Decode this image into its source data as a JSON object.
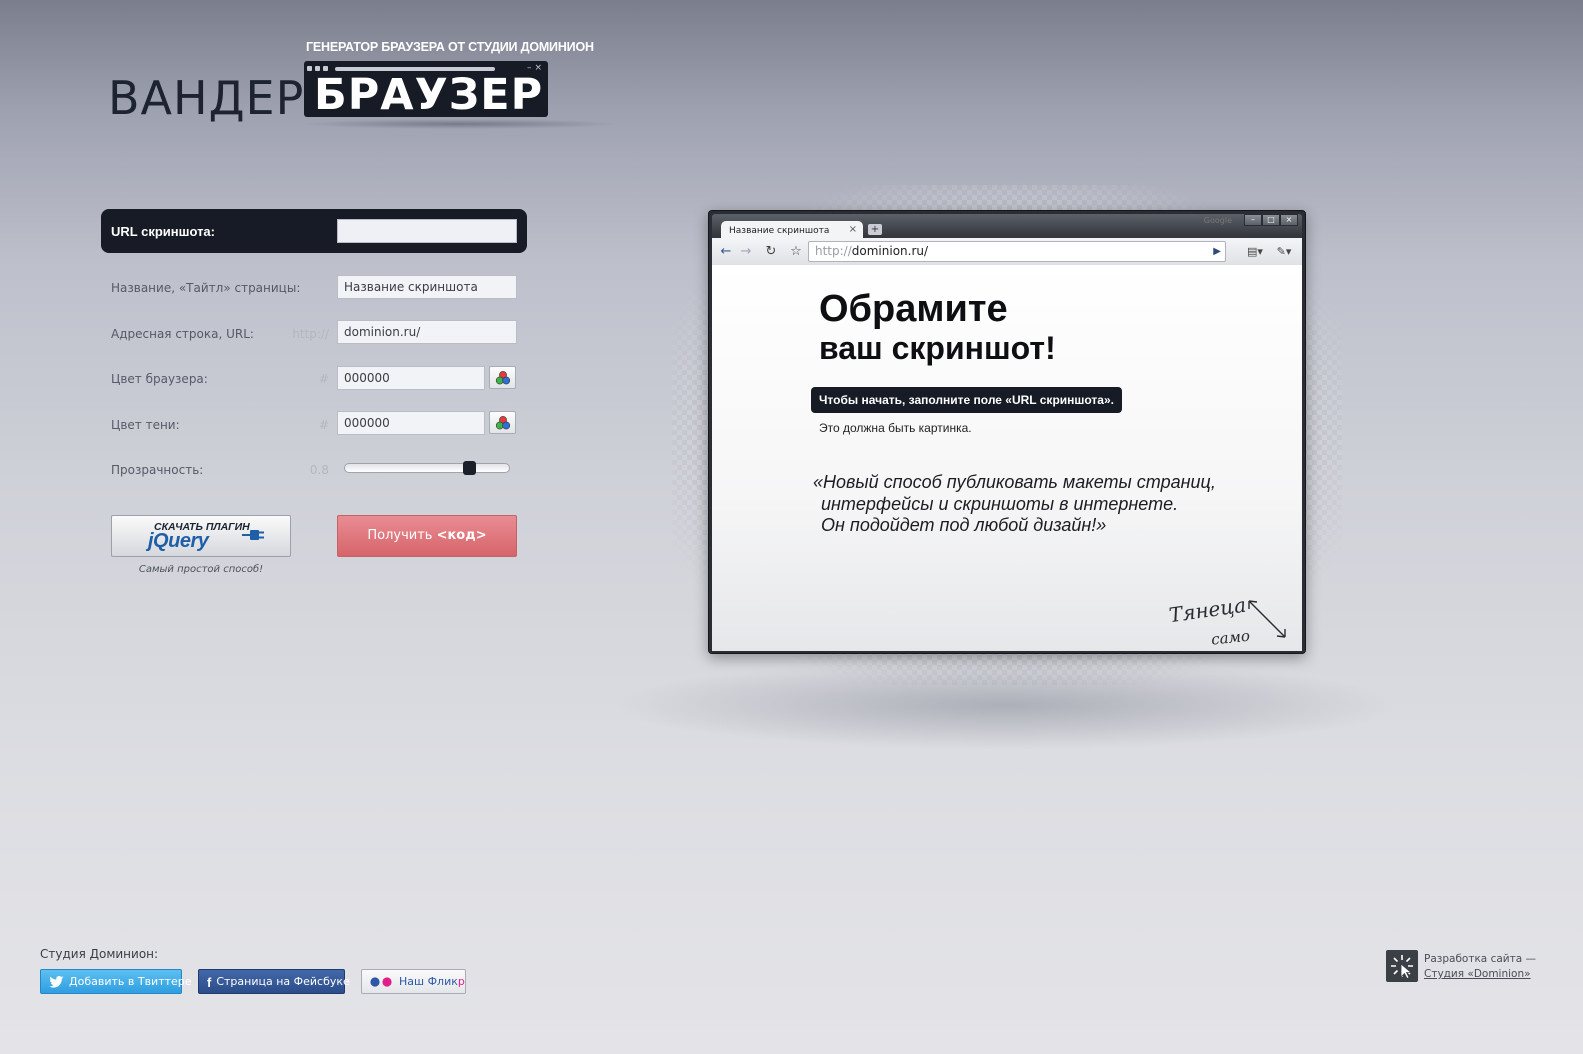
{
  "logo": {
    "subtitle": "ГЕНЕРАТОР БРАУЗЕРА ОТ СТУДИИ ДОМИНИОН",
    "left_word": "ВАНДЕР",
    "right_word": "БРАУЗЕР"
  },
  "form": {
    "screenshot_url": {
      "label": "URL скриншота:",
      "value": ""
    },
    "page_title": {
      "label": "Название, «Тайтл» страницы:",
      "value": "Название скриншота"
    },
    "address": {
      "label": "Адресная строка, URL:",
      "prefix": "http://",
      "value": "dominion.ru/"
    },
    "browser_color": {
      "label": "Цвет браузера:",
      "prefix": "#",
      "value": "000000"
    },
    "shadow_color": {
      "label": "Цвет тени:",
      "prefix": "#",
      "value": "000000"
    },
    "opacity": {
      "label": "Прозрачность:",
      "value_text": "0.8",
      "level": 0.8
    },
    "jquery_button": {
      "top_text": "СКАЧАТЬ ПЛАГИН",
      "brand": "jQuery",
      "caption": "Самый простой способ!"
    },
    "get_code_button": {
      "text": "Получить",
      "code": "<код>"
    }
  },
  "preview": {
    "tab_title": "Название скриншота",
    "tab_close": "×",
    "new_tab": "+",
    "corner_text": "Google",
    "window_controls": [
      "–",
      "□",
      "×"
    ],
    "address_proto": "http://",
    "address_host": "dominion.ru/",
    "heading_line1": "Обрамите",
    "heading_line2": "ваш скриншот!",
    "hint": "Чтобы начать, заполните поле «URL скриншота».",
    "hint_sub": "Это должна быть картинка.",
    "quote_line1": "«Новый способ публиковать макеты страниц,",
    "quote_line2": "интерфейсы и скриншоты в интернете.",
    "quote_line3": "Он подойдет под любой дизайн!»",
    "stretch_line1": "Тянеца",
    "stretch_line2": "само"
  },
  "footer": {
    "studio_label": "Студия Доминион:",
    "twitter": "Добавить в Твиттере",
    "facebook": "Страница на Фейсбуке",
    "flickr_prefix": "Наш Флик",
    "flickr_suffix": "р",
    "dev_text": "Разработка сайта —",
    "dev_link": "Студия «Dominion»"
  },
  "colors": {
    "dark": "#161b25",
    "accent_red": "#d6646b",
    "twitter": "#2f9ee0",
    "facebook": "#2c4d8a",
    "flickr_blue": "#2d58a8",
    "flickr_pink": "#e0208a"
  },
  "icons": [
    "color-picker-icon",
    "jquery-plug-icon",
    "back-icon",
    "forward-icon",
    "reload-icon",
    "star-icon",
    "go-icon",
    "page-icon",
    "wrench-icon",
    "twitter-bird-icon",
    "facebook-icon",
    "flickr-dots-icon",
    "dominion-logo-icon"
  ]
}
